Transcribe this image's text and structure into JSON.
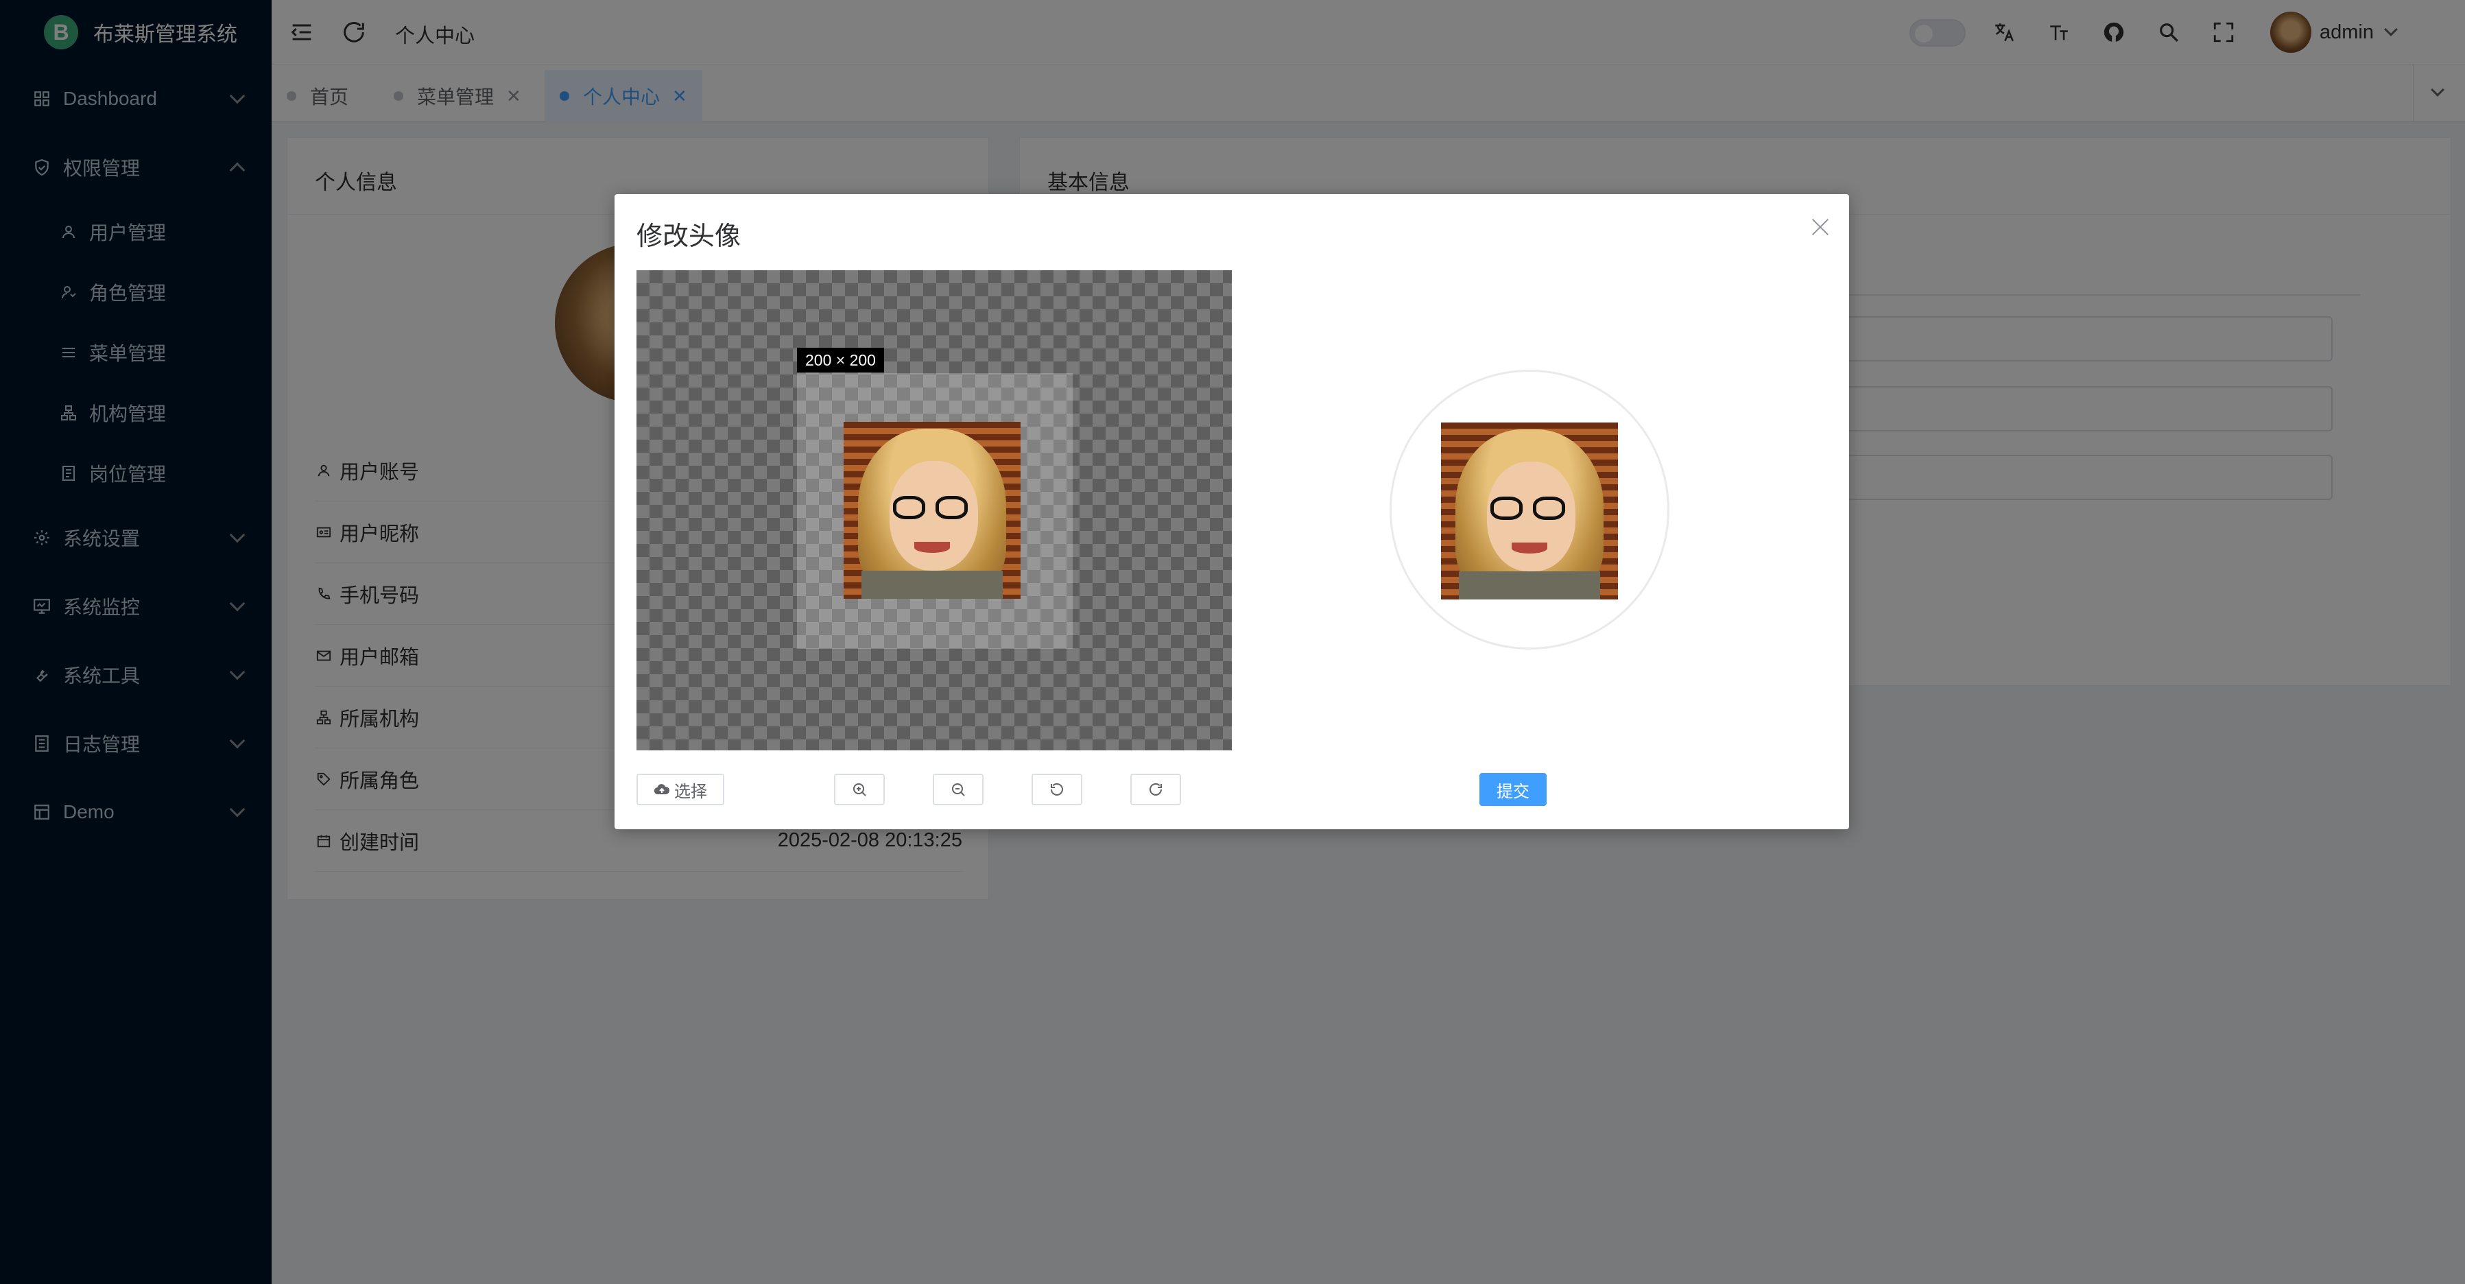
{
  "app": {
    "title": "布莱斯管理系统",
    "logo_letter": "B"
  },
  "sidebar": {
    "items": [
      {
        "label": "Dashboard",
        "icon": "dashboard-icon",
        "expanded": false
      },
      {
        "label": "权限管理",
        "icon": "shield-icon",
        "expanded": true,
        "children": [
          {
            "label": "用户管理",
            "icon": "user-icon"
          },
          {
            "label": "角色管理",
            "icon": "role-icon"
          },
          {
            "label": "菜单管理",
            "icon": "menu-list-icon"
          },
          {
            "label": "机构管理",
            "icon": "org-icon"
          },
          {
            "label": "岗位管理",
            "icon": "post-icon"
          }
        ]
      },
      {
        "label": "系统设置",
        "icon": "gear-icon",
        "expanded": false
      },
      {
        "label": "系统监控",
        "icon": "monitor-icon",
        "expanded": false
      },
      {
        "label": "系统工具",
        "icon": "wrench-icon",
        "expanded": false
      },
      {
        "label": "日志管理",
        "icon": "log-icon",
        "expanded": false
      },
      {
        "label": "Demo",
        "icon": "demo-icon",
        "expanded": false
      }
    ]
  },
  "header": {
    "breadcrumb": "个人中心",
    "user": {
      "name": "admin"
    },
    "icons": [
      "theme-toggle-icon",
      "translate-icon",
      "font-size-icon",
      "github-icon",
      "search-icon",
      "fullscreen-icon",
      "more-icon"
    ]
  },
  "tabs": [
    {
      "label": "首页",
      "active": false,
      "closable": false
    },
    {
      "label": "菜单管理",
      "active": false,
      "closable": true
    },
    {
      "label": "个人中心",
      "active": true,
      "closable": true
    }
  ],
  "profile_card": {
    "title": "个人信息",
    "rows": [
      {
        "label": "用户账号",
        "icon": "user-icon",
        "value": ""
      },
      {
        "label": "用户昵称",
        "icon": "id-card-icon",
        "value": ""
      },
      {
        "label": "手机号码",
        "icon": "phone-icon",
        "value": ""
      },
      {
        "label": "用户邮箱",
        "icon": "mail-icon",
        "value": ""
      },
      {
        "label": "所属机构",
        "icon": "org-icon",
        "value": ""
      },
      {
        "label": "所属角色",
        "icon": "tag-icon",
        "value": ""
      },
      {
        "label": "创建时间",
        "icon": "calendar-icon",
        "value": "2025-02-08 20:13:25"
      }
    ]
  },
  "basic_card": {
    "title": "基本信息"
  },
  "dialog": {
    "title": "修改头像",
    "crop_size_label": "200 × 200",
    "select_label": "选择",
    "submit_label": "提交",
    "tools": [
      "zoom-in-icon",
      "zoom-out-icon",
      "rotate-left-icon",
      "rotate-right-icon"
    ]
  }
}
